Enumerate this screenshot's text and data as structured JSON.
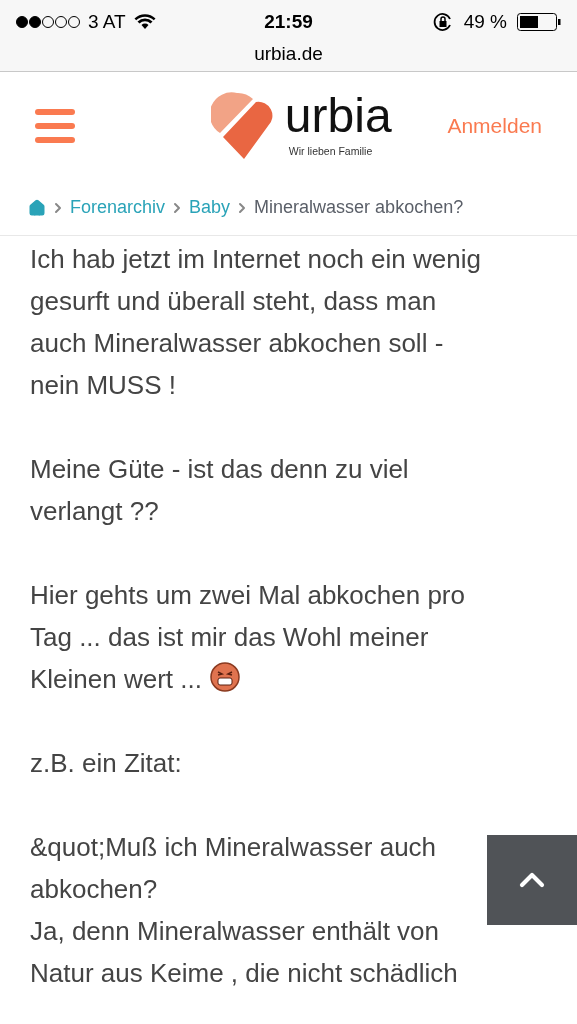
{
  "status_bar": {
    "carrier": "3 AT",
    "time": "21:59",
    "battery": "49 %"
  },
  "address_bar": {
    "url": "urbia.de"
  },
  "header": {
    "logo_name": "urbia",
    "logo_tagline": "Wir lieben Familie",
    "login": "Anmelden"
  },
  "breadcrumb": {
    "items": [
      "Forenarchiv",
      "Baby"
    ],
    "current": "Mineralwasser abkochen?"
  },
  "paragraphs": [
    {
      "lines": [
        "Ich hab jetzt im Internet noch ein wenig",
        "gesurft und überall steht, dass man",
        "auch Mineralwasser abkochen soll -",
        "nein MUSS !"
      ],
      "emoji": false
    },
    {
      "lines": [
        "Meine Güte - ist das denn zu viel",
        "verlangt ??"
      ],
      "emoji": false
    },
    {
      "lines": [
        "Hier gehts um zwei Mal abkochen pro",
        "Tag ... das ist mir das Wohl meiner",
        "Kleinen wert ..."
      ],
      "emoji": true
    },
    {
      "lines": [
        "z.B. ein Zitat:"
      ],
      "emoji": false
    },
    {
      "lines": [
        "&quot;Muß ich Mineralwasser auch",
        "abkochen?",
        "Ja, denn Mineralwasser enthält von",
        "Natur aus Keime , die nicht schädlich"
      ],
      "emoji": false
    }
  ]
}
